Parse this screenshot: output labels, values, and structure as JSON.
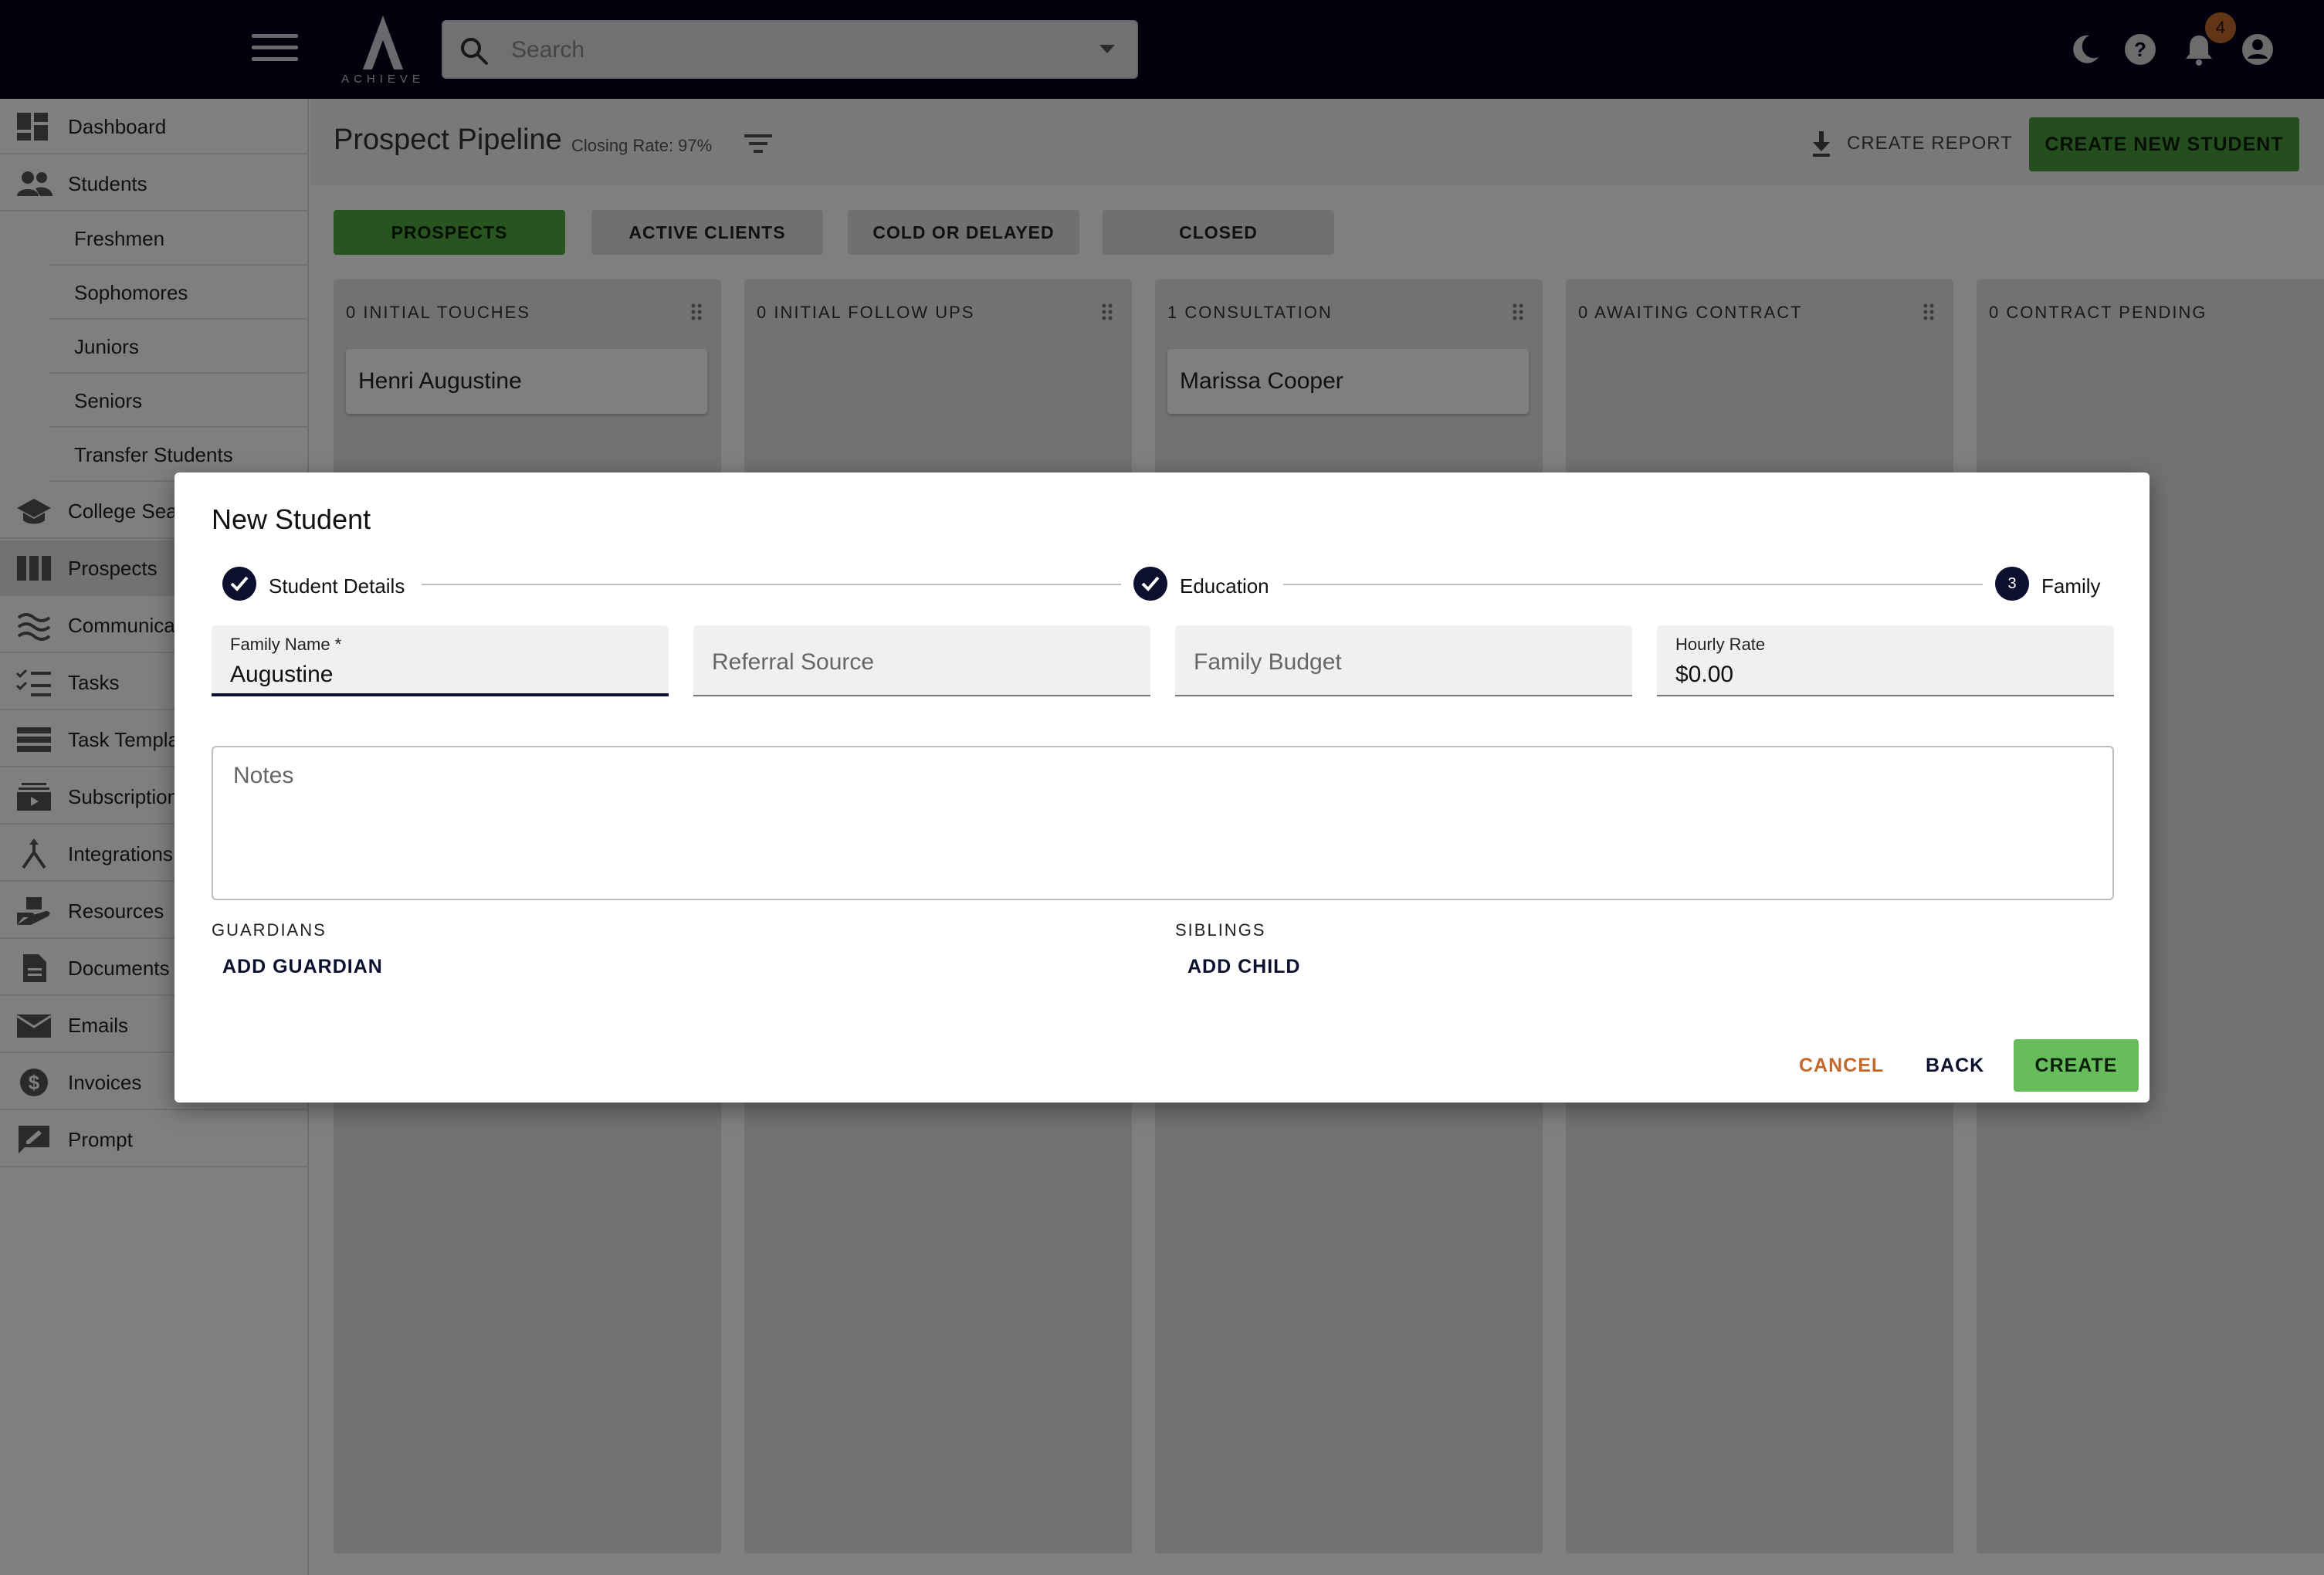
{
  "topbar": {
    "logo_text": "ACHIEVE",
    "search_placeholder": "Search",
    "notification_count": "4",
    "background_color": "#03051c"
  },
  "sidebar": {
    "items": [
      {
        "label": "Dashboard",
        "icon": "dashboard-icon"
      },
      {
        "label": "Students",
        "icon": "people-icon"
      },
      {
        "label": "College Search",
        "icon": "graduation-cap-icon"
      },
      {
        "label": "Prospects",
        "icon": "columns-icon"
      },
      {
        "label": "Communications",
        "icon": "waves-icon"
      },
      {
        "label": "Tasks",
        "icon": "checklist-icon"
      },
      {
        "label": "Task Templates",
        "icon": "list-icon"
      },
      {
        "label": "Subscriptions",
        "icon": "subscriptions-icon"
      },
      {
        "label": "Integrations",
        "icon": "merge-icon"
      },
      {
        "label": "Resources",
        "icon": "book-hand-icon"
      },
      {
        "label": "Documents",
        "icon": "document-icon"
      },
      {
        "label": "Emails",
        "icon": "mail-icon"
      },
      {
        "label": "Invoices",
        "icon": "dollar-icon"
      },
      {
        "label": "Prompt",
        "icon": "chat-edit-icon"
      }
    ],
    "student_subitems": [
      "Freshmen",
      "Sophomores",
      "Juniors",
      "Seniors",
      "Transfer Students"
    ],
    "active_item": "Prospects"
  },
  "page": {
    "title": "Prospect Pipeline",
    "closing_rate": "Closing Rate: 97%",
    "create_report_label": "CREATE REPORT",
    "create_student_label": "CREATE NEW STUDENT",
    "accent_color": "#4a9c3c"
  },
  "tabs": [
    {
      "label": "PROSPECTS",
      "active": true
    },
    {
      "label": "ACTIVE CLIENTS",
      "active": false
    },
    {
      "label": "COLD OR DELAYED",
      "active": false
    },
    {
      "label": "CLOSED",
      "active": false
    }
  ],
  "columns": [
    {
      "title": "0 INITIAL TOUCHES",
      "cards": [
        "Henri Augustine"
      ]
    },
    {
      "title": "0 INITIAL FOLLOW UPS",
      "cards": []
    },
    {
      "title": "1 CONSULTATION",
      "cards": [
        "Marissa Cooper"
      ]
    },
    {
      "title": "0 AWAITING CONTRACT",
      "cards": []
    },
    {
      "title": "0 CONTRACT PENDING",
      "cards": []
    }
  ],
  "modal": {
    "title": "New Student",
    "steps": [
      {
        "label": "Student Details",
        "status": "complete"
      },
      {
        "label": "Education",
        "status": "complete"
      },
      {
        "label": "Family",
        "status": "current",
        "number": "3"
      }
    ],
    "fields": {
      "family_name_label": "Family Name *",
      "family_name_value": "Augustine",
      "referral_source_placeholder": "Referral Source",
      "family_budget_placeholder": "Family Budget",
      "hourly_rate_label": "Hourly Rate",
      "hourly_rate_value": "$0.00",
      "notes_placeholder": "Notes"
    },
    "guardians_label": "GUARDIANS",
    "add_guardian_label": "ADD GUARDIAN",
    "siblings_label": "SIBLINGS",
    "add_child_label": "ADD CHILD",
    "cancel_label": "CANCEL",
    "back_label": "BACK",
    "create_label": "CREATE",
    "cancel_color": "#c26a2c",
    "create_color": "#67bd5b"
  }
}
